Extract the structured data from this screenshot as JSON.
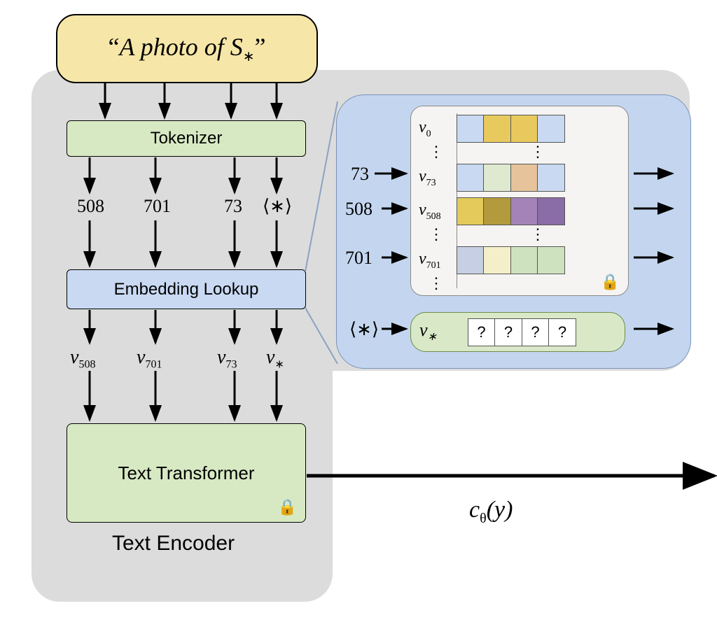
{
  "input_text": "“A photo of S∗”",
  "boxes": {
    "tokenizer": "Tokenizer",
    "embedding": "Embedding Lookup",
    "transformer": "Text Transformer",
    "encoder_label": "Text Encoder"
  },
  "tokens": {
    "ids": [
      "508",
      "701",
      "73",
      "⟨∗⟩"
    ],
    "embeddings": [
      "v_508",
      "v_701",
      "v_73",
      "v_*"
    ]
  },
  "lookup_detail": {
    "input_ids": [
      "73",
      "508",
      "701"
    ],
    "new_token_input": "⟨∗⟩",
    "rows": [
      {
        "key": "v_0",
        "colors": [
          "#c9d9f2",
          "#e8c95e",
          "#e8c95e",
          "#c9d9f2"
        ]
      },
      {
        "key": "v_73",
        "colors": [
          "#c9d9f2",
          "#dfe9cf",
          "#e6c39b",
          "#c9d9f2"
        ]
      },
      {
        "key": "v_508",
        "colors": [
          "#e3ca5a",
          "#b39a3c",
          "#a383b8",
          "#8a6ca6"
        ]
      },
      {
        "key": "v_701",
        "colors": [
          "#c6cfe3",
          "#f4efc9",
          "#cfe2c0",
          "#cfe2c0"
        ]
      }
    ],
    "new_token": {
      "key": "v_*",
      "cells": [
        "?",
        "?",
        "?",
        "?"
      ]
    },
    "locked": true
  },
  "output_symbol": "c_θ(y)",
  "colors": {
    "input_bg": "#f6e6a8",
    "tokenizer_bg": "#d7e9c3",
    "embedding_bg": "#c9d9f2",
    "detail_bg": "#c4d6ef",
    "encoder_bg": "#dcdcdc"
  }
}
